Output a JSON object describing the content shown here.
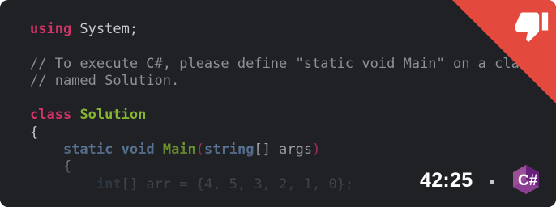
{
  "code": {
    "lines": [
      [
        {
          "t": "kw",
          "v": "using"
        },
        {
          "t": "txt",
          "v": " System;"
        }
      ],
      [],
      [
        {
          "t": "cm",
          "v": "// To execute C#, please define \"static void Main\" on a class"
        }
      ],
      [
        {
          "t": "cm",
          "v": "// named Solution."
        }
      ],
      [],
      [
        {
          "t": "kw",
          "v": "class"
        },
        {
          "t": "txt",
          "v": " "
        },
        {
          "t": "cls",
          "v": "Solution"
        }
      ],
      [
        {
          "t": "txt",
          "v": "{"
        }
      ],
      [
        {
          "t": "txt",
          "v": "    "
        },
        {
          "t": "kw2",
          "v": "static"
        },
        {
          "t": "txt",
          "v": " "
        },
        {
          "t": "kw2",
          "v": "void"
        },
        {
          "t": "txt",
          "v": " "
        },
        {
          "t": "cls",
          "v": "Main"
        },
        {
          "t": "par",
          "v": "("
        },
        {
          "t": "kw2",
          "v": "string"
        },
        {
          "t": "txt",
          "v": "[] args"
        },
        {
          "t": "par",
          "v": ")"
        }
      ],
      [
        {
          "t": "txt",
          "v": "    {"
        }
      ],
      [
        {
          "t": "txt",
          "v": "        "
        },
        {
          "t": "kw2",
          "v": "int"
        },
        {
          "t": "txt",
          "v": "[] arr = {4, 5, 3, 2, 1, 0};"
        }
      ]
    ]
  },
  "badge": {
    "icon": "thumbs-down-icon",
    "color": "#e3493d"
  },
  "duration": "42:25",
  "language": {
    "icon": "csharp-logo-icon",
    "label": "C#",
    "color": "#9b4f96"
  }
}
